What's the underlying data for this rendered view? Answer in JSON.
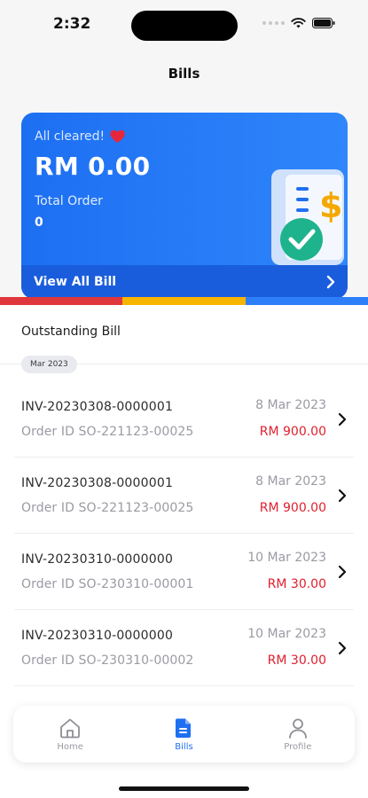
{
  "status_bar": {
    "time": "2:32"
  },
  "header": {
    "title": "Bills"
  },
  "summary": {
    "status_text": "All cleared!",
    "amount": "RM 0.00",
    "total_order_label": "Total Order",
    "total_order_value": "0",
    "view_all_label": "View All Bill"
  },
  "strip_colors": [
    "#e0373c",
    "#f7b500",
    "#2d7ff9"
  ],
  "outstanding": {
    "title": "Outstanding Bill",
    "month_chip": "Mar 2023",
    "bills": [
      {
        "invoice": "INV-20230308-0000001",
        "order_id": "Order ID SO-221123-00025",
        "date": "8 Mar 2023",
        "amount": "RM 900.00"
      },
      {
        "invoice": "INV-20230308-0000001",
        "order_id": "Order ID SO-221123-00025",
        "date": "8 Mar 2023",
        "amount": "RM 900.00"
      },
      {
        "invoice": "INV-20230310-0000000",
        "order_id": "Order ID SO-230310-00001",
        "date": "10 Mar 2023",
        "amount": "RM 30.00"
      },
      {
        "invoice": "INV-20230310-0000000",
        "order_id": "Order ID SO-230310-00002",
        "date": "10 Mar 2023",
        "amount": "RM 30.00"
      }
    ]
  },
  "tab_bar": {
    "tabs": [
      {
        "label": "Home",
        "icon": "home-icon",
        "active": false
      },
      {
        "label": "Bills",
        "icon": "bill-document-icon",
        "active": true
      },
      {
        "label": "Profile",
        "icon": "user-icon",
        "active": false
      }
    ]
  },
  "colors": {
    "accent": "#1f6ff2",
    "amount_red": "#e0202f",
    "card_blue": "#2f86fb"
  }
}
